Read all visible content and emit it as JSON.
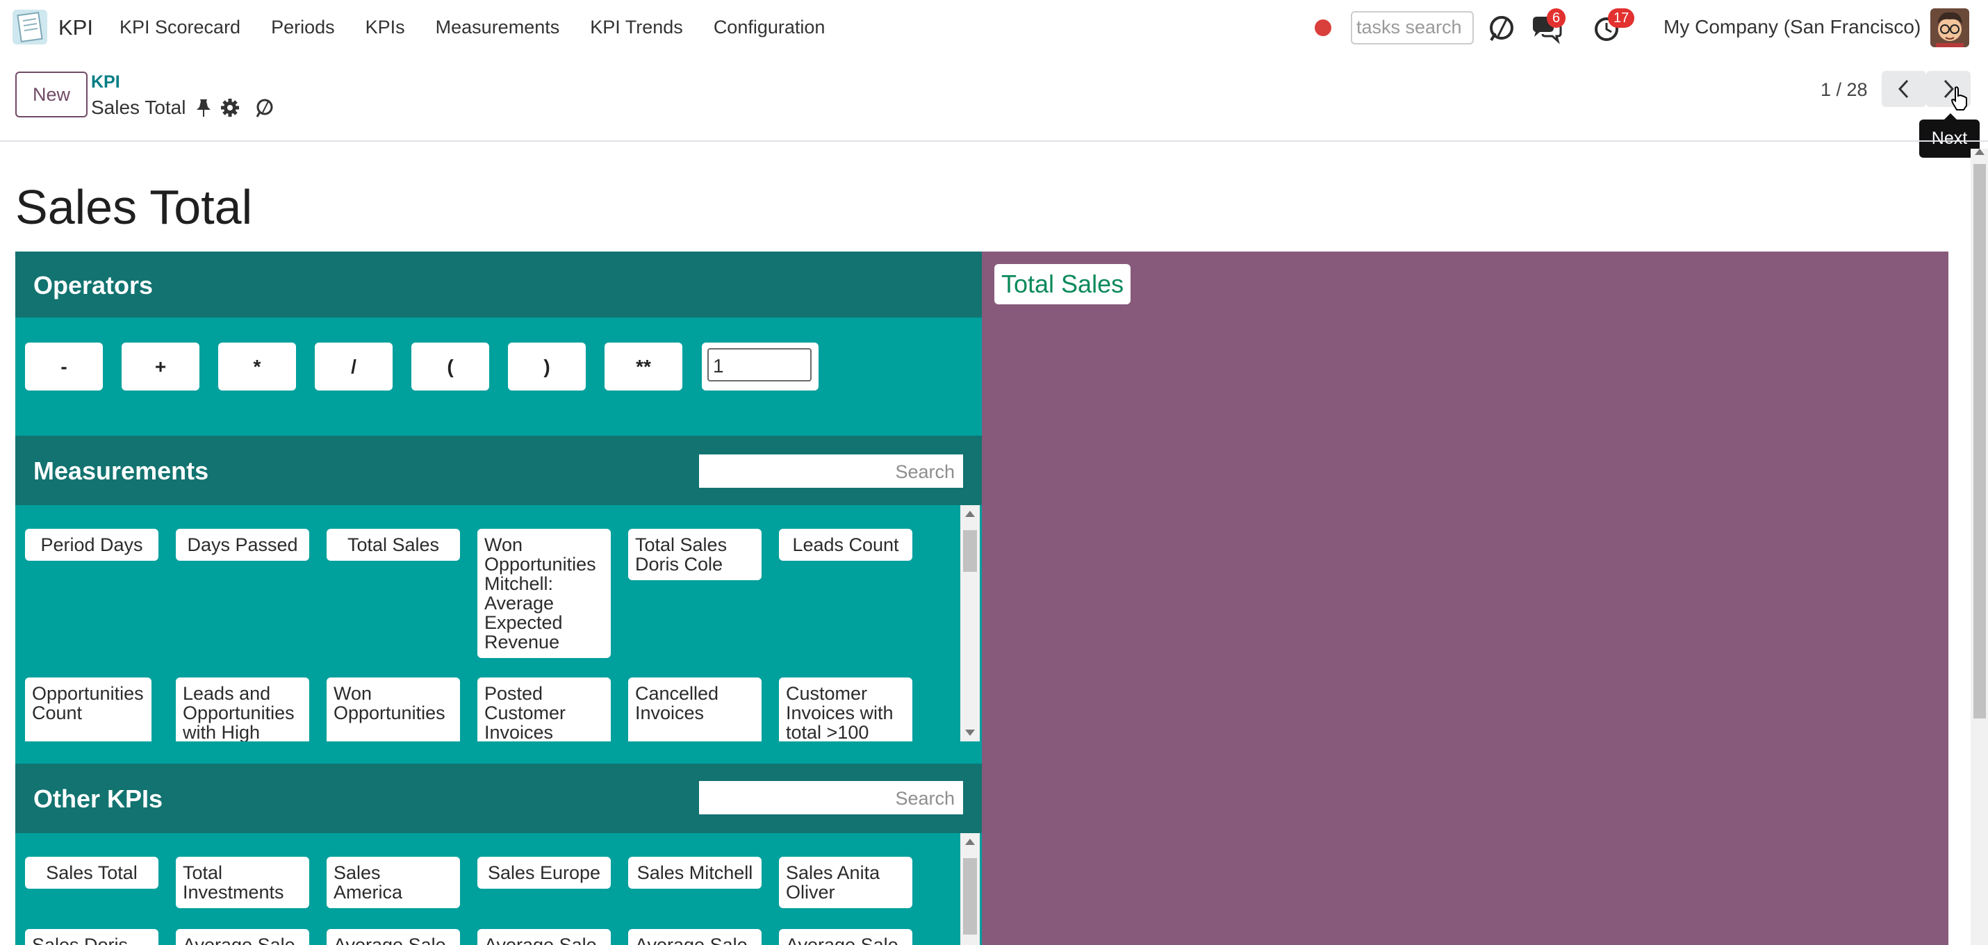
{
  "nav": {
    "app_name": "KPI",
    "menu": [
      "KPI Scorecard",
      "Periods",
      "KPIs",
      "Measurements",
      "KPI Trends",
      "Configuration"
    ],
    "task_search_placeholder": "tasks search",
    "messages_count": "6",
    "activities_count": "17",
    "company": "My Company (San Francisco)"
  },
  "control_panel": {
    "new_label": "New",
    "breadcrumb_parent": "KPI",
    "breadcrumb_current": "Sales Total",
    "pager": "1 / 28",
    "tooltip": "Next"
  },
  "record": {
    "title": "Sales Total"
  },
  "operators": {
    "title": "Operators",
    "buttons": [
      "-",
      "+",
      "*",
      "/",
      "(",
      ")",
      "**"
    ],
    "number_value": "1"
  },
  "measurements": {
    "title": "Measurements",
    "search_placeholder": "Search",
    "items": [
      "Period Days",
      "Days Passed",
      "Total Sales",
      "Won Opportunities Mitchell: Average Expected Revenue",
      "Total Sales Doris Cole",
      "Leads Count",
      "Opportunities Count",
      "Leads and Opportunities with High",
      "Won Opportunities",
      "Posted Customer Invoices",
      "Cancelled Invoices",
      "Customer Invoices with total >100"
    ]
  },
  "other_kpis": {
    "title": "Other KPIs",
    "search_placeholder": "Search",
    "items": [
      "Sales Total",
      "Total Investments",
      "Sales America",
      "Sales Europe",
      "Sales Mitchell",
      "Sales Anita Oliver",
      "Sales Doris",
      "Average Sale",
      "Average Sale",
      "Average Sale",
      "Average Sale",
      "Average Sale"
    ]
  },
  "formula": {
    "items": [
      "Total Sales"
    ]
  },
  "colors": {
    "primary": "#714b67",
    "teal": "#00a09d",
    "teal_dark": "#127370",
    "formula_bg": "#875a7b",
    "link": "#017e84"
  }
}
